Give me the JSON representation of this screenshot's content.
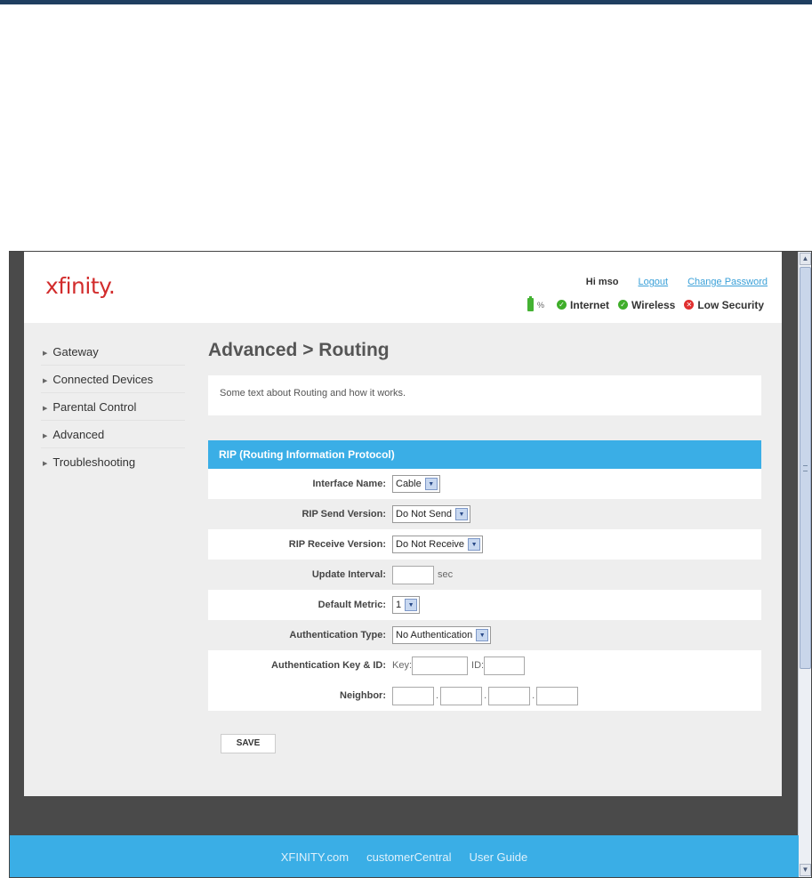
{
  "header": {
    "logo": "xfinity.",
    "greeting": "Hi mso",
    "logout": "Logout",
    "change_password": "Change Password",
    "battery_pct": "%",
    "status": [
      {
        "label": "Internet",
        "state": "ok"
      },
      {
        "label": "Wireless",
        "state": "ok"
      },
      {
        "label": "Low Security",
        "state": "warning"
      }
    ]
  },
  "sidebar": {
    "items": [
      {
        "label": "Gateway"
      },
      {
        "label": "Connected Devices"
      },
      {
        "label": "Parental Control"
      },
      {
        "label": "Advanced"
      },
      {
        "label": "Troubleshooting"
      }
    ]
  },
  "main": {
    "title": "Advanced > Routing",
    "description": "Some text about Routing and how it works.",
    "panel_title": "RIP (Routing Information Protocol)",
    "fields": {
      "interface_name": {
        "label": "Interface Name:",
        "value": "Cable"
      },
      "rip_send_version": {
        "label": "RIP Send Version:",
        "value": "Do Not Send"
      },
      "rip_receive_version": {
        "label": "RIP Receive Version:",
        "value": "Do Not Receive"
      },
      "update_interval": {
        "label": "Update Interval:",
        "value": "",
        "unit": "sec"
      },
      "default_metric": {
        "label": "Default Metric:",
        "value": "1"
      },
      "authentication_type": {
        "label": "Authentication Type:",
        "value": "No Authentication"
      },
      "auth_key_id": {
        "label": "Authentication Key & ID:",
        "key_label": "Key:",
        "id_label": "ID:",
        "key_value": "",
        "id_value": ""
      },
      "neighbor": {
        "label": "Neighbor:",
        "octets": [
          "",
          "",
          "",
          ""
        ],
        "separator": "."
      }
    },
    "save_label": "SAVE"
  },
  "footer": {
    "links": [
      "XFINITY.com",
      "customerCentral",
      "User Guide"
    ]
  },
  "colors": {
    "accent": "#3aaee6",
    "brand_red": "#d22c2c",
    "status_ok": "#3fae2a",
    "status_bad": "#e03030"
  },
  "icons": {
    "battery": "battery-icon",
    "ok": "check-circle-icon",
    "warning": "x-circle-icon",
    "select": "chevron-down-icon"
  }
}
